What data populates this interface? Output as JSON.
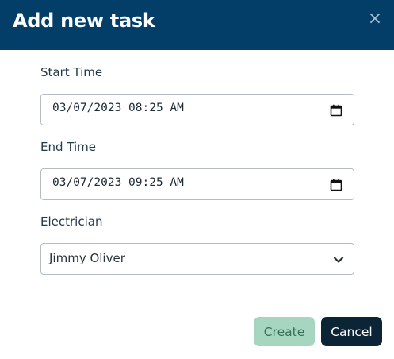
{
  "dialog": {
    "title": "Add new task",
    "close_glyph": "×"
  },
  "form": {
    "start_time": {
      "label": "Start Time",
      "value": "03/07/2023 08:25 AM",
      "icon": "calendar-icon"
    },
    "end_time": {
      "label": "End Time",
      "value": "03/07/2023 09:25 AM",
      "icon": "calendar-icon"
    },
    "electrician": {
      "label": "Electrician",
      "selected": "Jimmy Oliver",
      "icon": "chevron-down-icon"
    }
  },
  "footer": {
    "create_label": "Create",
    "cancel_label": "Cancel"
  },
  "colors": {
    "header_bg": "#023e67",
    "create_bg": "#a6d6bf",
    "cancel_bg": "#0b2436"
  }
}
